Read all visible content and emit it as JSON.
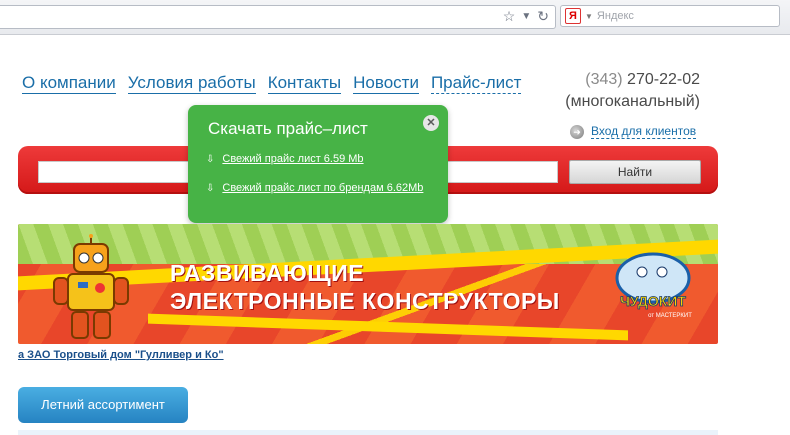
{
  "browser": {
    "search_placeholder": "Яндекс",
    "search_engine_letter": "Я"
  },
  "nav": {
    "items": [
      {
        "label": "О компании"
      },
      {
        "label": "Условия работы"
      },
      {
        "label": "Контакты"
      },
      {
        "label": "Новости"
      },
      {
        "label": "Прайс-лист"
      }
    ]
  },
  "phone": {
    "code": "(343)",
    "number": "270-22-02",
    "note": "(многоканальный)"
  },
  "login": {
    "label": "Вход для клиентов"
  },
  "search": {
    "button_label": "Найти",
    "value": ""
  },
  "popup": {
    "title": "Скачать прайс–лист",
    "links": [
      {
        "label": "Свежий прайс лист 6.59 Mb"
      },
      {
        "label": "Свежий прайс лист по брендам 6.62Mb"
      }
    ]
  },
  "banner": {
    "line1": "РАЗВИВАЮЩИЕ",
    "line2": "ЭЛЕКТРОННЫЕ КОНСТРУКТОРЫ",
    "logo_text": "ЧУДОКИТ",
    "logo_sub": "от МАСТЕРКИТ"
  },
  "company_link": "а ЗАО Торговый дом \"Гулливер и Ко\"",
  "summer_button": "Летний ассортимент",
  "colors": {
    "accent_link": "#1a6ea8",
    "search_bar": "#e02626",
    "popup_bg": "#47b346",
    "summer_button": "#3597d3"
  }
}
